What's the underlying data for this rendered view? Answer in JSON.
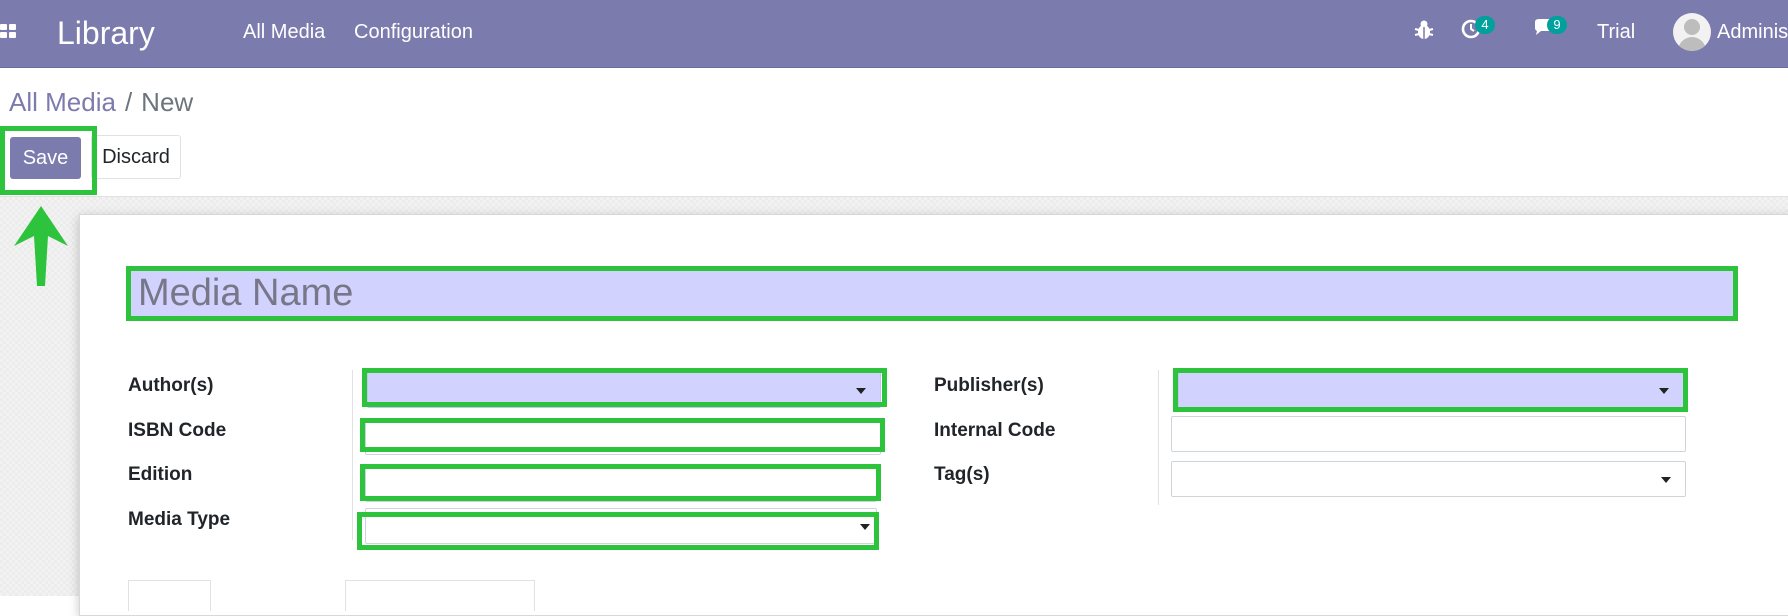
{
  "navbar": {
    "app_name": "Library",
    "menu": [
      {
        "label": "All Media"
      },
      {
        "label": "Configuration"
      }
    ],
    "icons": {
      "apps": "apps-grid-icon",
      "debug": "bug-icon",
      "activities": "clock-icon",
      "messages": "chat-icon"
    },
    "activity_count": "4",
    "message_count": "9",
    "trial_label": "Trial",
    "user_name": "Administrator",
    "color": "#7c7bad"
  },
  "breadcrumb": {
    "parent": "All Media",
    "separator": "/",
    "current": "New"
  },
  "buttons": {
    "save": "Save",
    "discard": "Discard"
  },
  "form": {
    "name_placeholder": "Media Name",
    "required_color": "#d2d2ff",
    "left_fields": [
      {
        "label": "Author(s)",
        "value": "",
        "type": "many2many-select",
        "required": true
      },
      {
        "label": "ISBN Code",
        "value": "",
        "type": "text",
        "required": false
      },
      {
        "label": "Edition",
        "value": "",
        "type": "text",
        "required": false
      },
      {
        "label": "Media Type",
        "value": "",
        "type": "select",
        "required": false
      }
    ],
    "right_fields": [
      {
        "label": "Publisher(s)",
        "value": "",
        "type": "many2many-select",
        "required": true
      },
      {
        "label": "Internal Code",
        "value": "",
        "type": "text",
        "required": false
      },
      {
        "label": "Tag(s)",
        "value": "",
        "type": "many2many-select",
        "required": false
      }
    ]
  },
  "annotations": {
    "highlight_color": "#2ec33d",
    "arrow_icon": "up-arrow-icon"
  }
}
